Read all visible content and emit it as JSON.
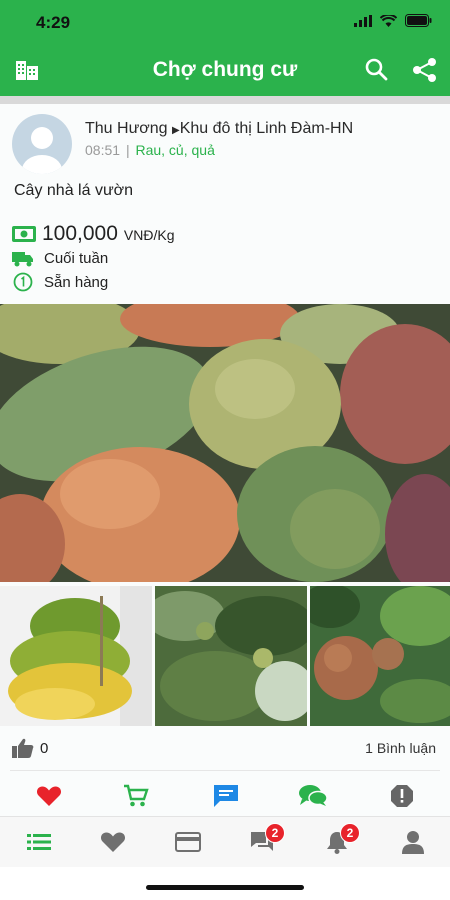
{
  "status_bar": {
    "time": "4:29"
  },
  "header": {
    "title": "Chợ chung cư",
    "left_icon": "building-icon",
    "right_icons": [
      "search-icon",
      "share-icon"
    ]
  },
  "post": {
    "author": "Thu Hương",
    "location": "Khu đô thị Linh Đàm-HN",
    "time": "08:51",
    "separator": "|",
    "category": "Rau, củ, quả",
    "title": "Cây nhà lá vườn",
    "price": "100,000",
    "price_unit": "VNĐ/Kg",
    "delivery": "Cuối tuần",
    "availability": "Sẵn hàng",
    "likes": "0",
    "comments": "1 Bình luận"
  },
  "actions": [
    "heart-icon",
    "cart-icon",
    "message-icon",
    "chat-icon",
    "report-icon"
  ],
  "bottom_nav": {
    "items": [
      "list-icon",
      "heart-icon",
      "card-icon",
      "chat-icon",
      "bell-icon",
      "user-icon"
    ],
    "chat_badge": "2",
    "bell_badge": "2"
  },
  "colors": {
    "brand": "#2bb24c",
    "like": "#e8232b",
    "message": "#1e88e5"
  }
}
